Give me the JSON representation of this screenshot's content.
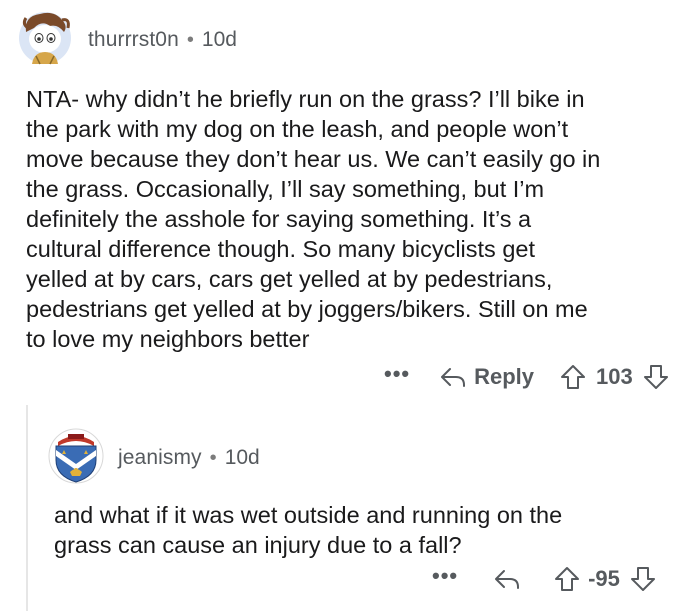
{
  "comment": {
    "username": "thurrrst0n",
    "separator": "•",
    "age": "10d",
    "body": [
      "NTA- why didn’t he briefly run on the grass? I’ll bike in",
      "the park with my dog on the leash, and people won’t",
      "move because they don’t hear us. We can’t easily go in",
      "the grass. Occasionally, I’ll say something, but I’m",
      "definitely the asshole for saying something. It’s a",
      "cultural difference though. So many bicyclists get",
      "yelled at by cars, cars get yelled at by pedestrians,",
      "pedestrians get yelled at by joggers/bikers. Still on me",
      "to love my neighbors better"
    ],
    "actions": {
      "more": "•••",
      "reply_label": "Reply",
      "score": "103"
    }
  },
  "reply": {
    "username": "jeanismy",
    "separator": "•",
    "age": "10d",
    "body": [
      "and what if it was wet outside and running on the",
      "grass can cause an injury due to a fall?"
    ],
    "actions": {
      "more": "•••",
      "score": "-95"
    }
  },
  "icons": {
    "reply": "reply-arrow-icon",
    "upvote": "upvote-arrow-icon",
    "downvote": "downvote-arrow-icon"
  },
  "colors": {
    "meta_text": "#565a5e",
    "body_text": "#1a1a1b",
    "avatar_blue": "#c8d9f2",
    "crest_blue": "#3a6cb5",
    "crest_red": "#c0392b",
    "crest_gold": "#e2b23a"
  }
}
